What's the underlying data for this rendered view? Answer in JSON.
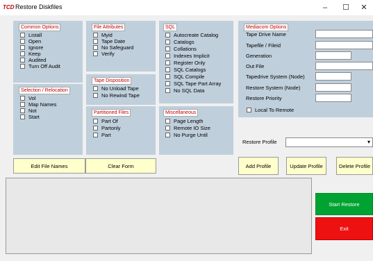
{
  "window": {
    "app_icon_text": "TCD",
    "title": "Restore Diskfiles",
    "minimize_glyph": "–",
    "maximize_glyph": "☐",
    "close_glyph": "✕"
  },
  "common_options": {
    "title": "Common Options",
    "items": [
      "Listall",
      "Open",
      "Ignore",
      "Keep",
      "Audited",
      "Turn Off Audit"
    ]
  },
  "selection_relocation": {
    "title": "Selection / Relocation",
    "items": [
      "Vol",
      "Map Names",
      "Not",
      "Start"
    ]
  },
  "file_attributes": {
    "title": "File Attributes",
    "items": [
      "Myid",
      "Tape Date",
      "No Safeguard",
      "Verify"
    ]
  },
  "tape_disposition": {
    "title": "Tape Disposition",
    "items": [
      "No Unload Tape",
      "No Rewind Tape"
    ]
  },
  "partitioned_files": {
    "title": "Partitioned Files",
    "items": [
      "Part Of",
      "Partonly",
      "Part"
    ]
  },
  "sql": {
    "title": "SQL",
    "items": [
      "Autocreate Catalog",
      "Catalogs",
      "Collations",
      "Indexes Implicit",
      "Register Only",
      "SQL Catalogs",
      "SQL Compile",
      "SQL Tape Part Array",
      "No SQL Data"
    ]
  },
  "miscellaneous": {
    "title": "Miscellaneous",
    "items": [
      "Page Length",
      "Remote IO Size",
      "No Purge Until"
    ]
  },
  "mediacom": {
    "title": "Mediacom Options",
    "fields": [
      "Tape Drive Name",
      "Tapefile / Fileid",
      "Generation",
      "Out File",
      "Tapedrive System (Node)",
      "Restore System (Node)",
      "Restore Priority"
    ],
    "local_to_remote": "Local To Remote"
  },
  "restore_profile": {
    "label": "Restore Profile",
    "value": "",
    "arrow": "▾"
  },
  "buttons": {
    "edit_file_names": "Edit File Names",
    "clear_form": "Clear Form",
    "add_profile": "Add Profile",
    "update_profile": "Update Profile",
    "delete_profile": "Delete Profile",
    "start_restore": "Start Restore",
    "exit": "Exit"
  },
  "colors": {
    "panel": "#bfcfdc",
    "section_title": "#c00000",
    "button_face": "#ffffcc",
    "start_restore": "#00a331",
    "exit": "#ee1111"
  }
}
